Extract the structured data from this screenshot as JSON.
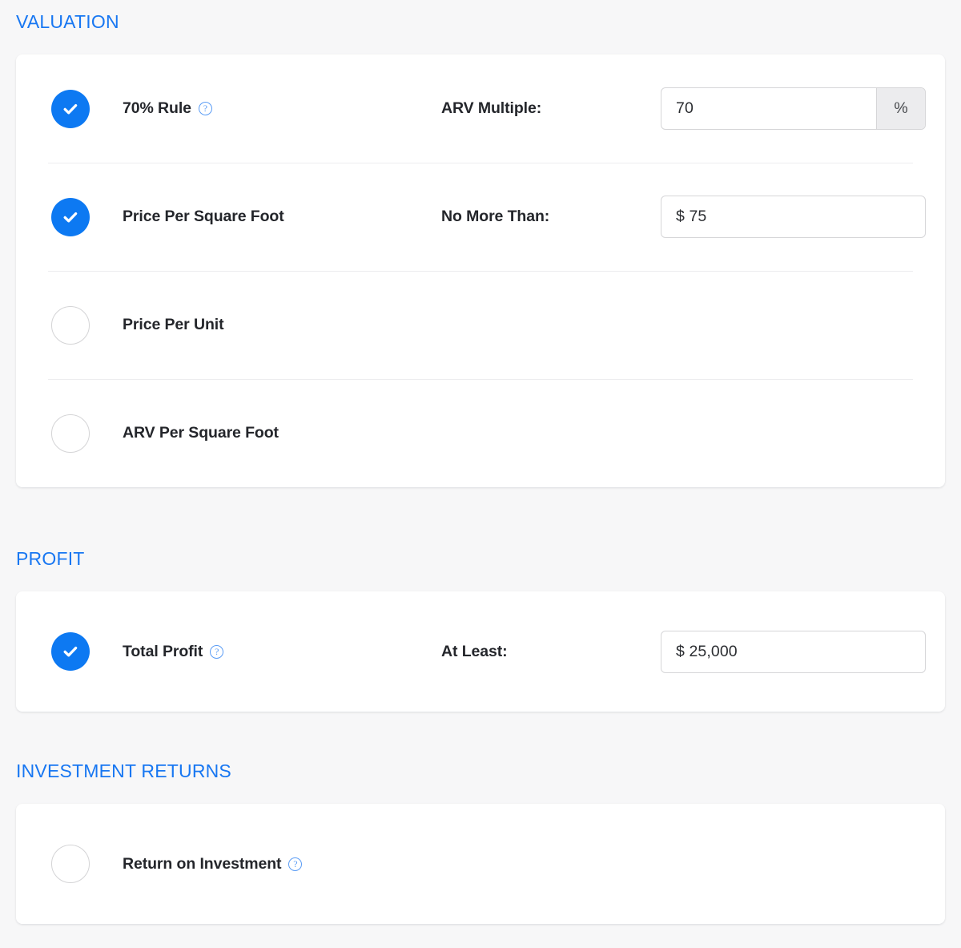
{
  "theme": {
    "accent": "#1877f2",
    "check_fill": "#0d79f2",
    "page_bg": "#f7f7f8",
    "card_bg": "#ffffff",
    "text": "#24262b",
    "help_icon_color": "#5a9cf5",
    "suffix_bg": "#ececee"
  },
  "sections": [
    {
      "title": "VALUATION",
      "rows": [
        {
          "checked": true,
          "label": "70% Rule",
          "help": "?",
          "has_help": true,
          "mid_label": "ARV Multiple:",
          "value": "70",
          "suffix": "%",
          "has_input": true,
          "has_suffix": true
        },
        {
          "checked": true,
          "label": "Price Per Square Foot",
          "has_help": false,
          "mid_label": "No More Than:",
          "value": "$ 75",
          "has_input": true,
          "has_suffix": false
        },
        {
          "checked": false,
          "label": "Price Per Unit",
          "has_help": false,
          "mid_label": "",
          "value": "",
          "has_input": false,
          "has_suffix": false
        },
        {
          "checked": false,
          "label": "ARV Per Square Foot",
          "has_help": false,
          "mid_label": "",
          "value": "",
          "has_input": false,
          "has_suffix": false
        }
      ]
    },
    {
      "title": "PROFIT",
      "rows": [
        {
          "checked": true,
          "label": "Total Profit",
          "help": "?",
          "has_help": true,
          "mid_label": "At Least:",
          "value": "$ 25,000",
          "has_input": true,
          "has_suffix": false
        }
      ]
    },
    {
      "title": "INVESTMENT RETURNS",
      "rows": [
        {
          "checked": false,
          "label": "Return on Investment",
          "help": "?",
          "has_help": true,
          "mid_label": "",
          "value": "",
          "has_input": false,
          "has_suffix": false
        }
      ]
    }
  ]
}
